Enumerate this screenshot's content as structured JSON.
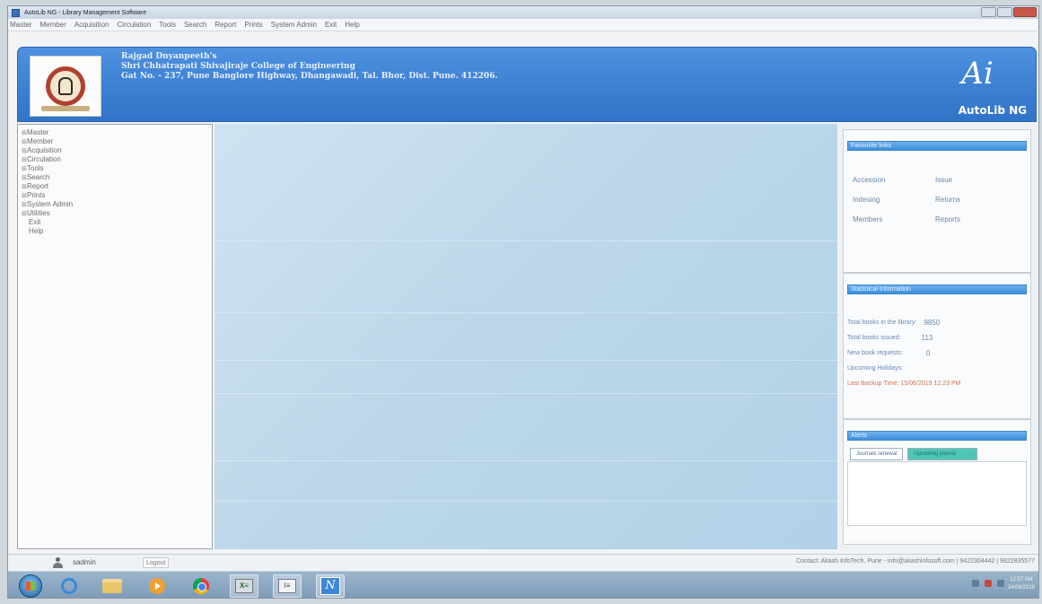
{
  "window": {
    "title": "AutoLib NG - Library Management Software"
  },
  "menubar": [
    "Master",
    "Member",
    "Acquisition",
    "Circulation",
    "Tools",
    "Search",
    "Report",
    "Prints",
    "System Admin",
    "Exit",
    "Help"
  ],
  "header": {
    "line1": "Rajgad Dnyanpeeth's",
    "line2": "Shri Chhatrapati Shivajiraje College of Engineering",
    "line3": "Gat No. - 237, Pune Banglore Highway, Dhangawadi, Tal. Bhor, Dist. Pune. 412206.",
    "brand_mark": "Ai",
    "brand_name": "AutoLib NG"
  },
  "tree": [
    {
      "label": "Master",
      "expandable": true
    },
    {
      "label": "Member",
      "expandable": true
    },
    {
      "label": "Acquisition",
      "expandable": true
    },
    {
      "label": "Circulation",
      "expandable": true
    },
    {
      "label": "Tools",
      "expandable": true
    },
    {
      "label": "Search",
      "expandable": true
    },
    {
      "label": "Report",
      "expandable": true
    },
    {
      "label": "Prints",
      "expandable": true
    },
    {
      "label": "System Admin",
      "expandable": true
    },
    {
      "label": "Utilities",
      "expandable": true
    },
    {
      "label": "Exit",
      "expandable": false
    },
    {
      "label": "Help",
      "expandable": false
    }
  ],
  "favorites": {
    "title": "Favourite links",
    "links": [
      "Accession",
      "Issue",
      "Indexing",
      "Returns",
      "Members",
      "Reports"
    ]
  },
  "stats": {
    "title": "Statistical Information",
    "total_books_label": "Total books in the library:",
    "total_books_value": "9850",
    "issued_label": "Total books issued:",
    "issued_value": "113",
    "requests_label": "New book requests:",
    "requests_value": "0",
    "holidays_label": "Upcoming Holidays:",
    "backup_label": "Last Backup Time: 15/06/2019 12:23 PM"
  },
  "alerts": {
    "title": "Alerts",
    "tab1": "Journals renewal",
    "tab2": "Upcoming journal"
  },
  "status": {
    "username": "sadmin",
    "logout": "Logout",
    "contact": "Contact: Akash InfoTech, Pune - info@akashinfosoft.com | 9422304442 | 9822835577"
  },
  "taskbar": {
    "clock_time": "12:57 AM",
    "clock_date": "24/06/2019"
  },
  "colors": {
    "header_blue": "#3f83d4",
    "panel_head": "#4a96df",
    "backup_text": "#d27359"
  }
}
